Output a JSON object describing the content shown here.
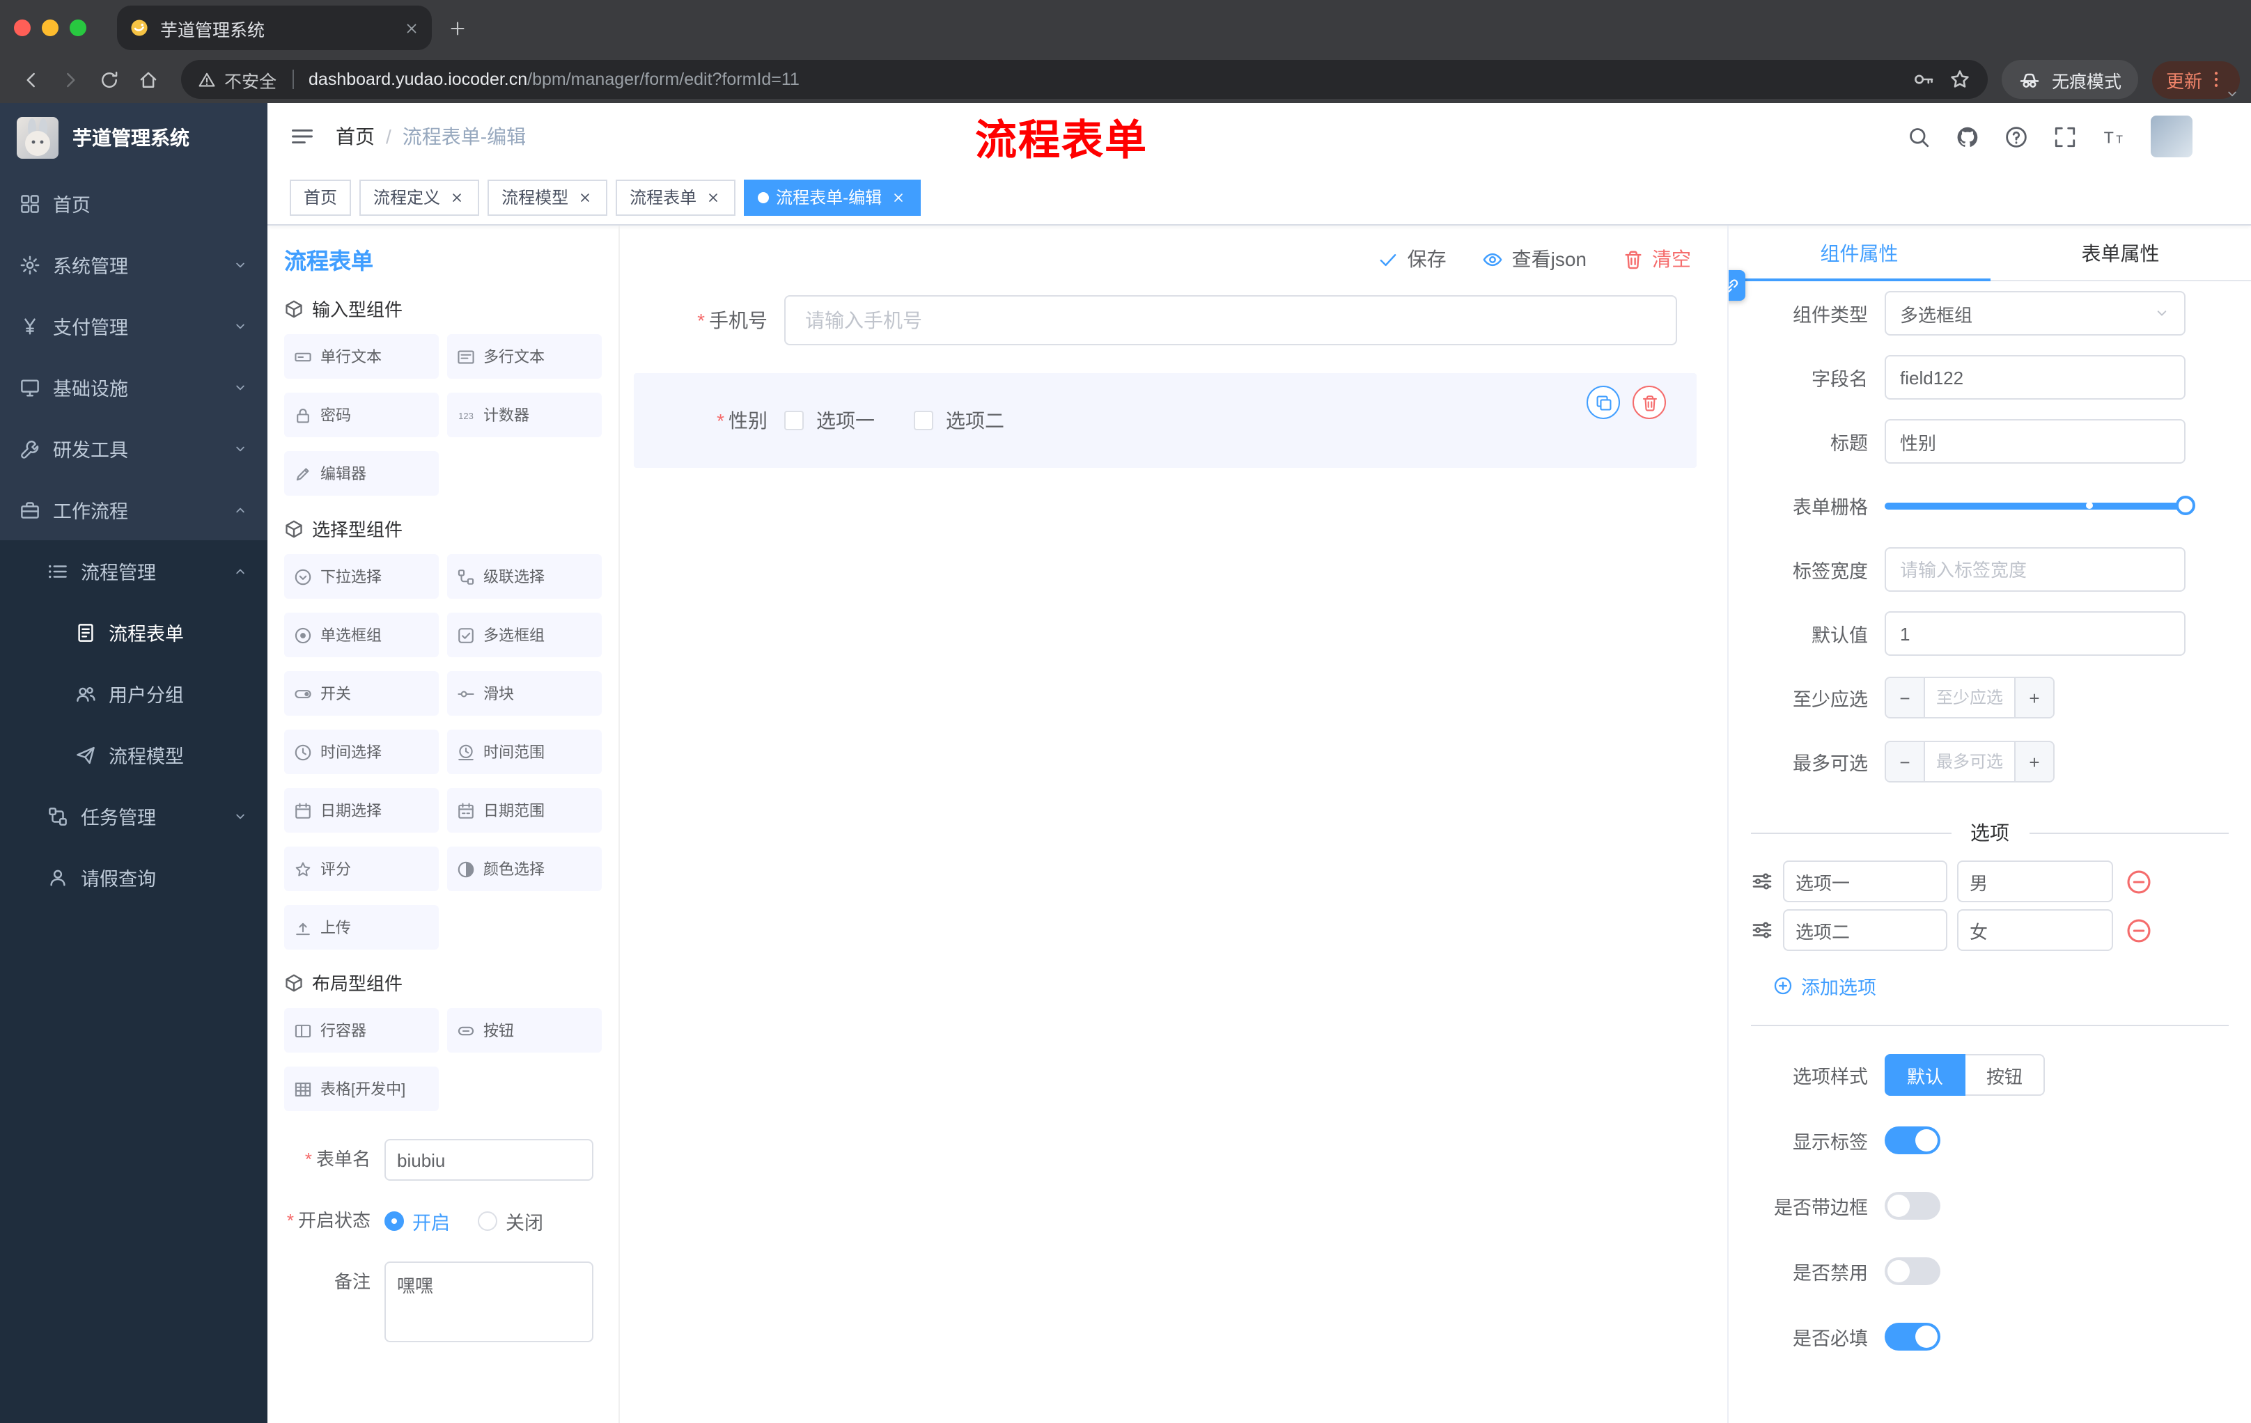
{
  "colors": {
    "accent": "#409EFF",
    "danger": "#F56C6C",
    "annotation_red": "#FF0000",
    "sidebar_bg": "#2D3A4D",
    "submenu_bg": "#1F2D3D",
    "chip_bg": "#F6F7FF",
    "selected_bg": "#F4F6FE",
    "chrome_bg": "#3B3C3F",
    "chrome_dark": "#27282B",
    "update_bg": "#4A2E28",
    "update_text": "#F0846A"
  },
  "browser": {
    "tab": {
      "title": "芋道管理系统"
    },
    "address": {
      "security_label": "不安全",
      "domain": "dashboard.yudao.iocoder.cn",
      "path": "/bpm/manager/form/edit?formId=11"
    },
    "incognito_label": "无痕模式",
    "update_label": "更新"
  },
  "sidebar": {
    "logo_title": "芋道管理系统",
    "items": [
      {
        "name": "home",
        "label": "首页",
        "icon": "home-icon",
        "level": 1
      },
      {
        "name": "system-management",
        "label": "系统管理",
        "icon": "gear-icon",
        "level": 1,
        "expand": "down"
      },
      {
        "name": "payment-management",
        "label": "支付管理",
        "icon": "yen-icon",
        "level": 1,
        "expand": "down"
      },
      {
        "name": "infrastructure",
        "label": "基础设施",
        "icon": "infra-icon",
        "level": 1,
        "expand": "down"
      },
      {
        "name": "dev-tools",
        "label": "研发工具",
        "icon": "tools-icon",
        "level": 1,
        "expand": "down"
      },
      {
        "name": "workflow",
        "label": "工作流程",
        "icon": "workflow-icon",
        "level": 1,
        "expand": "up"
      },
      {
        "name": "process-management",
        "label": "流程管理",
        "icon": "process-icon",
        "level": 2,
        "expand": "up"
      },
      {
        "name": "process-form",
        "label": "流程表单",
        "icon": "form-icon",
        "level": 3,
        "active": true
      },
      {
        "name": "user-group",
        "label": "用户分组",
        "icon": "group-icon",
        "level": 3
      },
      {
        "name": "process-model",
        "label": "流程模型",
        "icon": "model-icon",
        "level": 3
      },
      {
        "name": "task-management",
        "label": "任务管理",
        "icon": "task-icon",
        "level": 2,
        "expand": "down"
      },
      {
        "name": "leave-query",
        "label": "请假查询",
        "icon": "user-icon",
        "level": 2
      }
    ]
  },
  "header": {
    "breadcrumb_root": "首页",
    "breadcrumb_current": "流程表单-编辑",
    "annotation": "流程表单"
  },
  "tags": [
    {
      "label": "首页",
      "closable": false,
      "active": false
    },
    {
      "label": "流程定义",
      "closable": true,
      "active": false
    },
    {
      "label": "流程模型",
      "closable": true,
      "active": false
    },
    {
      "label": "流程表单",
      "closable": true,
      "active": false
    },
    {
      "label": "流程表单-编辑",
      "closable": true,
      "active": true
    }
  ],
  "designer": {
    "title": "流程表单",
    "actions": {
      "save": "保存",
      "view_json": "查看json",
      "clear": "清空"
    },
    "palette": [
      {
        "title": "输入型组件",
        "items": [
          {
            "label": "单行文本",
            "icon": "single-line-icon"
          },
          {
            "label": "多行文本",
            "icon": "multi-line-icon"
          },
          {
            "label": "密码",
            "icon": "password-icon"
          },
          {
            "label": "计数器",
            "icon": "counter-icon"
          },
          {
            "label": "编辑器",
            "icon": "editor-icon"
          }
        ]
      },
      {
        "title": "选择型组件",
        "items": [
          {
            "label": "下拉选择",
            "icon": "select-icon"
          },
          {
            "label": "级联选择",
            "icon": "cascader-icon"
          },
          {
            "label": "单选框组",
            "icon": "radio-group-icon"
          },
          {
            "label": "多选框组",
            "icon": "checkbox-group-icon"
          },
          {
            "label": "开关",
            "icon": "switch-icon"
          },
          {
            "label": "滑块",
            "icon": "slider-icon"
          },
          {
            "label": "时间选择",
            "icon": "time-icon"
          },
          {
            "label": "时间范围",
            "icon": "time-range-icon"
          },
          {
            "label": "日期选择",
            "icon": "date-icon"
          },
          {
            "label": "日期范围",
            "icon": "date-range-icon"
          },
          {
            "label": "评分",
            "icon": "rate-icon"
          },
          {
            "label": "颜色选择",
            "icon": "color-icon"
          },
          {
            "label": "上传",
            "icon": "upload-icon"
          }
        ]
      },
      {
        "title": "布局型组件",
        "items": [
          {
            "label": "行容器",
            "icon": "row-icon"
          },
          {
            "label": "按钮",
            "icon": "button-icon"
          },
          {
            "label": "表格[开发中]",
            "icon": "table-icon"
          }
        ]
      }
    ],
    "meta": {
      "form_name_label": "表单名",
      "form_name_value": "biubiu",
      "status_label": "开启状态",
      "status_options": [
        {
          "label": "开启",
          "checked": true
        },
        {
          "label": "关闭",
          "checked": false
        }
      ],
      "remark_label": "备注",
      "remark_value": "嘿嘿"
    },
    "canvas": {
      "phone": {
        "label": "手机号",
        "placeholder": "请输入手机号"
      },
      "gender": {
        "label": "性别",
        "options": [
          "选项一",
          "选项二"
        ]
      }
    }
  },
  "props": {
    "tabs": [
      {
        "label": "组件属性",
        "active": true
      },
      {
        "label": "表单属性",
        "active": false
      }
    ],
    "component_type_label": "组件类型",
    "component_type_value": "多选框组",
    "field_name_label": "字段名",
    "field_name_value": "field122",
    "title_label": "标题",
    "title_value": "性别",
    "grid_label": "表单栅格",
    "label_width_label": "标签宽度",
    "label_width_placeholder": "请输入标签宽度",
    "default_label": "默认值",
    "default_value": "1",
    "steppers": [
      {
        "label": "至少应选",
        "placeholder": "至少应选"
      },
      {
        "label": "最多可选",
        "placeholder": "最多可选"
      }
    ],
    "options_title": "选项",
    "options": [
      {
        "name": "选项一",
        "value": "男"
      },
      {
        "name": "选项二",
        "value": "女"
      }
    ],
    "add_option_label": "添加选项",
    "option_style_label": "选项样式",
    "option_style_choices": [
      {
        "label": "默认",
        "active": true
      },
      {
        "label": "按钮",
        "active": false
      }
    ],
    "switches": [
      {
        "label": "显示标签",
        "on": true
      },
      {
        "label": "是否带边框",
        "on": false
      },
      {
        "label": "是否禁用",
        "on": false
      },
      {
        "label": "是否必填",
        "on": true
      }
    ]
  }
}
